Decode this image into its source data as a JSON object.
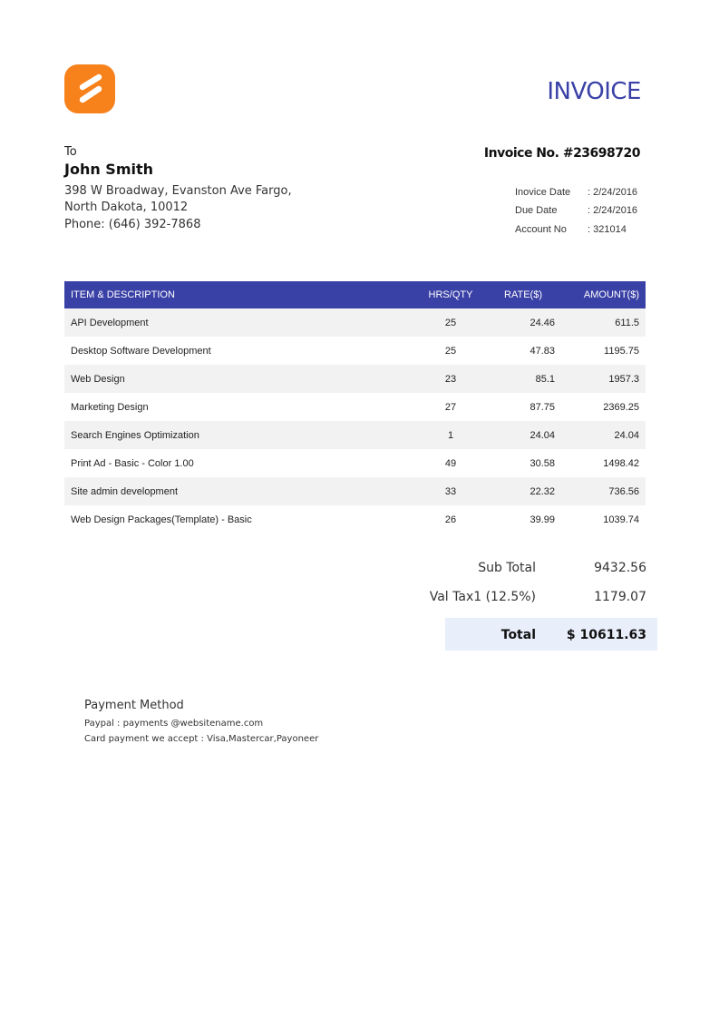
{
  "colors": {
    "brand_orange": "#f7811b",
    "accent_blue": "#3a41a6",
    "total_bg": "#e8eefa"
  },
  "logo": {
    "icon": "s-logo-icon"
  },
  "title": "INVOICE",
  "client": {
    "to_label": "To",
    "name": "John Smith",
    "address_line1": "398 W Broadway, Evanston Ave Fargo,",
    "address_line2": "North Dakota, 10012",
    "phone": "Phone: (646) 392-7868"
  },
  "invoice": {
    "number": "Invoice No. #23698720",
    "fields": [
      {
        "label": "Inovice Date",
        "value": ": 2/24/2016"
      },
      {
        "label": "Due Date",
        "value": ": 2/24/2016"
      },
      {
        "label": "Account No",
        "value": ": 321014"
      }
    ]
  },
  "table": {
    "headers": {
      "description": "ITEM & DESCRIPTION",
      "qty": "HRS/QTY",
      "rate": "RATE($)",
      "amount": "AMOUNT($)"
    },
    "rows": [
      {
        "description": "API Development",
        "qty": "25",
        "rate": "24.46",
        "amount": "611.5"
      },
      {
        "description": "Desktop Software Development",
        "qty": "25",
        "rate": "47.83",
        "amount": "1195.75"
      },
      {
        "description": "Web Design",
        "qty": "23",
        "rate": "85.1",
        "amount": "1957.3"
      },
      {
        "description": "Marketing Design",
        "qty": "27",
        "rate": "87.75",
        "amount": "2369.25"
      },
      {
        "description": "Search Engines Optimization",
        "qty": "1",
        "rate": "24.04",
        "amount": "24.04"
      },
      {
        "description": "Print Ad - Basic - Color 1.00",
        "qty": "49",
        "rate": "30.58",
        "amount": "1498.42"
      },
      {
        "description": "Site admin development",
        "qty": "33",
        "rate": "22.32",
        "amount": "736.56"
      },
      {
        "description": "Web Design Packages(Template) - Basic",
        "qty": "26",
        "rate": "39.99",
        "amount": "1039.74"
      }
    ]
  },
  "summary": {
    "subtotal_label": "Sub Total",
    "subtotal_value": "9432.56",
    "tax_label": "Val Tax1 (12.5%)",
    "tax_value": "1179.07",
    "total_label": "Total",
    "total_value": "$ 10611.63"
  },
  "payment": {
    "title": "Payment Method",
    "paypal": "Paypal : payments @websitename.com",
    "cards": "Card payment we accept : Visa,Mastercar,Payoneer"
  }
}
